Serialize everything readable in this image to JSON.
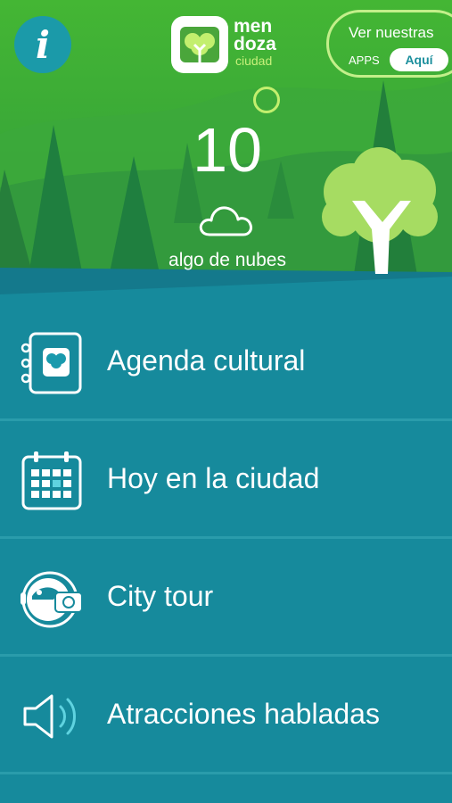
{
  "header": {
    "info_icon_glyph": "i",
    "logo": {
      "word1": "men",
      "word2": "doza",
      "word3": "ciudad"
    },
    "apps_banner": {
      "line1": "Ver nuestras",
      "line2": "APPS",
      "button": "Aquí"
    }
  },
  "weather": {
    "temperature": "10",
    "condition": "algo de nubes",
    "icon": "cloud-icon"
  },
  "menu": {
    "items": [
      {
        "label": "Agenda cultural",
        "icon": "agenda-icon"
      },
      {
        "label": "Hoy en la ciudad",
        "icon": "calendar-icon"
      },
      {
        "label": "City tour",
        "icon": "tour-bus-icon"
      },
      {
        "label": "Atracciones habladas",
        "icon": "speaker-icon"
      }
    ]
  },
  "colors": {
    "teal": "#168a9c",
    "green": "#3aa838",
    "light_green": "#a6dc62",
    "accent": "#c3ef8a"
  }
}
